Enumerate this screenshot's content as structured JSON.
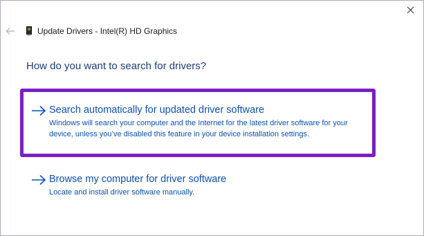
{
  "window": {
    "title": "Update Drivers - Intel(R) HD Graphics",
    "close_icon": "close-icon",
    "back_icon": "back-arrow-icon",
    "device_icon": "display-adapter-icon"
  },
  "main": {
    "question": "How do you want to search for drivers?",
    "options": [
      {
        "title": "Search automatically for updated driver software",
        "description": "Windows will search your computer and the Internet for the latest driver software for your device, unless you’ve disabled this feature in your device installation settings.",
        "icon": "arrow-right-icon",
        "highlighted": true
      },
      {
        "title": "Browse my computer for driver software",
        "description": "Locate and install driver software manually.",
        "icon": "arrow-right-icon",
        "highlighted": false
      }
    ]
  },
  "colors": {
    "link": "#0b4fb3",
    "heading": "#1f3b7a",
    "highlight_border": "#7a1fc2",
    "window_border": "#b9a3c7"
  }
}
